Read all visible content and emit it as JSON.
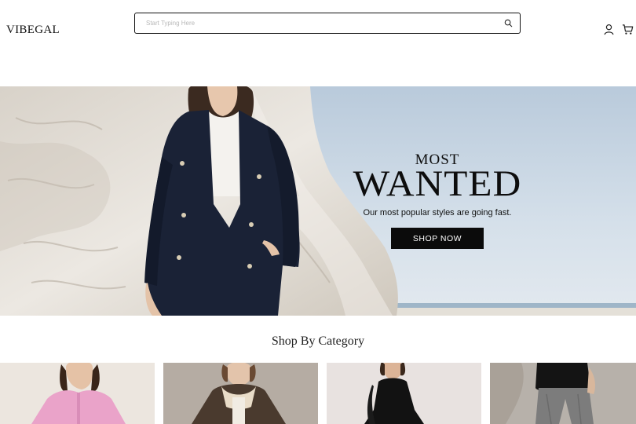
{
  "header": {
    "logo": "VIBEGAL",
    "search": {
      "placeholder": "Start Typing Here",
      "value": ""
    },
    "icons": {
      "search": "search-icon",
      "account": "user-icon",
      "cart": "cart-icon"
    }
  },
  "hero": {
    "kicker": "MOST",
    "title": "WANTED",
    "subtitle": "Our most popular styles are going fast.",
    "cta_label": "SHOP NOW",
    "colors": {
      "sky": "#c9d7e4",
      "cliff": "#e6e1da",
      "coat": "#1a2236",
      "button": "#0b0b0b"
    }
  },
  "categories": {
    "title": "Shop By Category",
    "items": [
      {
        "image": "pink-cardigan-photo",
        "accent": "#e9a9cc"
      },
      {
        "image": "brown-shearling-jacket-photo",
        "accent": "#4a3a2e"
      },
      {
        "image": "black-dress-photo",
        "accent": "#111111"
      },
      {
        "image": "grey-trousers-photo",
        "accent": "#7c7c7c"
      }
    ]
  }
}
